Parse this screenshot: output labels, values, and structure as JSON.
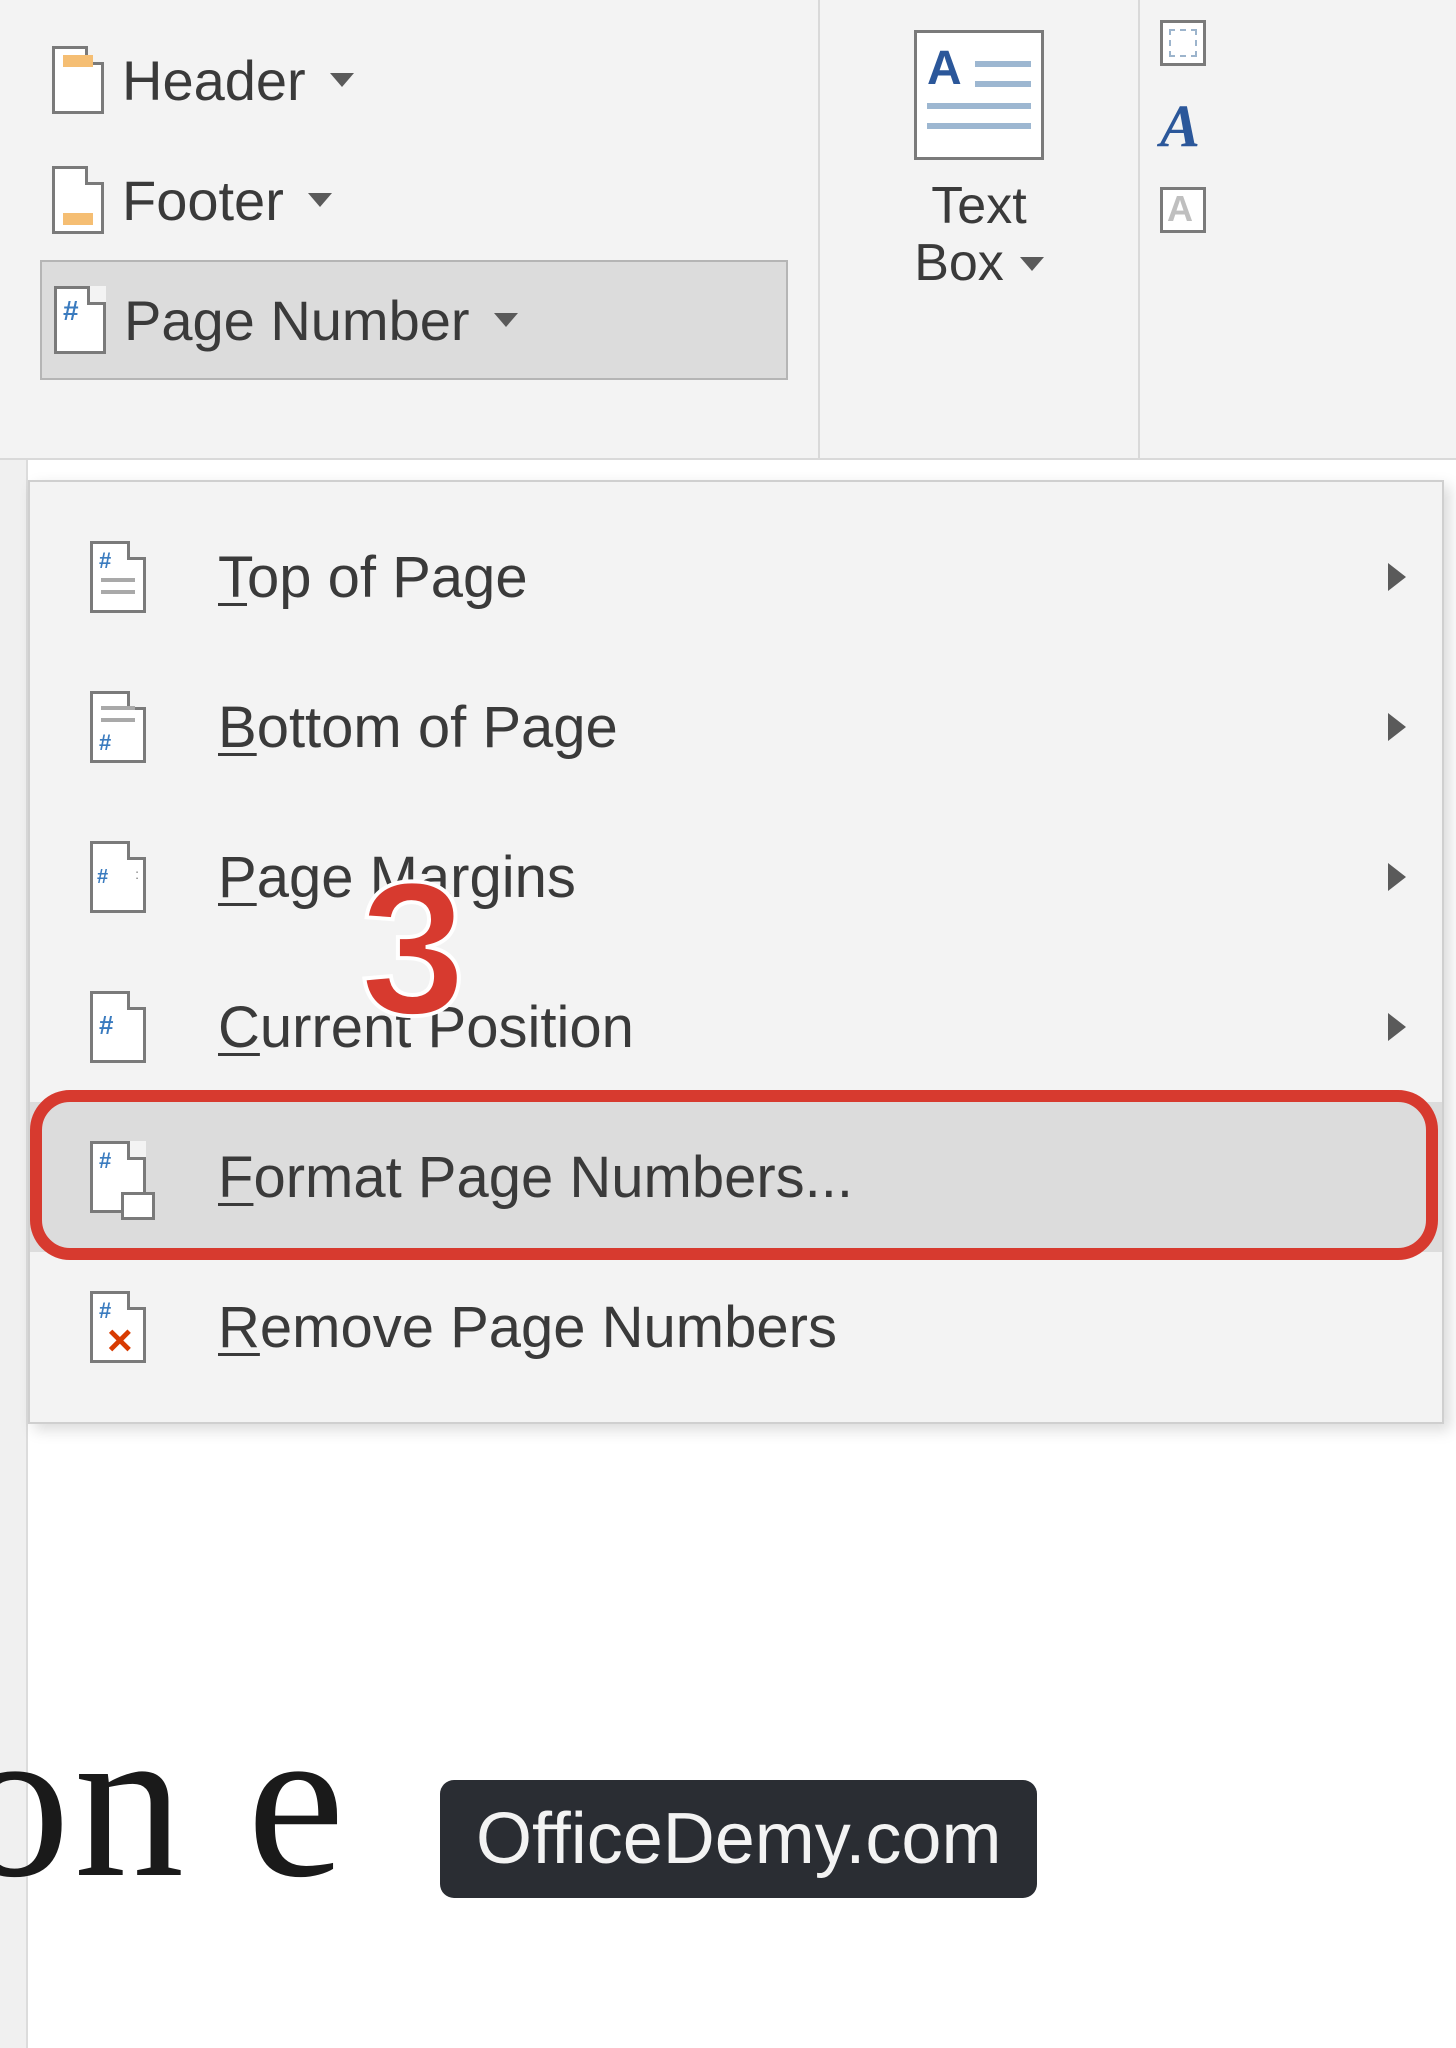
{
  "ribbon": {
    "header_label": "Header",
    "footer_label": "Footer",
    "page_number_label": "Page Number",
    "textbox_line1": "Text",
    "textbox_line2": "Box"
  },
  "page_number_menu": {
    "items": [
      {
        "label": "Top of Page",
        "underline": "T",
        "has_submenu": true
      },
      {
        "label": "Bottom of Page",
        "underline": "B",
        "has_submenu": true
      },
      {
        "label": "Page Margins",
        "underline": "P",
        "has_submenu": true
      },
      {
        "label": "Current Position",
        "underline": "C",
        "has_submenu": true
      },
      {
        "label": "Format Page Numbers...",
        "underline": "F",
        "has_submenu": false,
        "hovered": true
      },
      {
        "label": "Remove Page Numbers",
        "underline": "R",
        "has_submenu": false
      }
    ]
  },
  "annotation": {
    "step_number": "3"
  },
  "watermark": "OfficeDemy.com",
  "background_doc_text": "on e"
}
